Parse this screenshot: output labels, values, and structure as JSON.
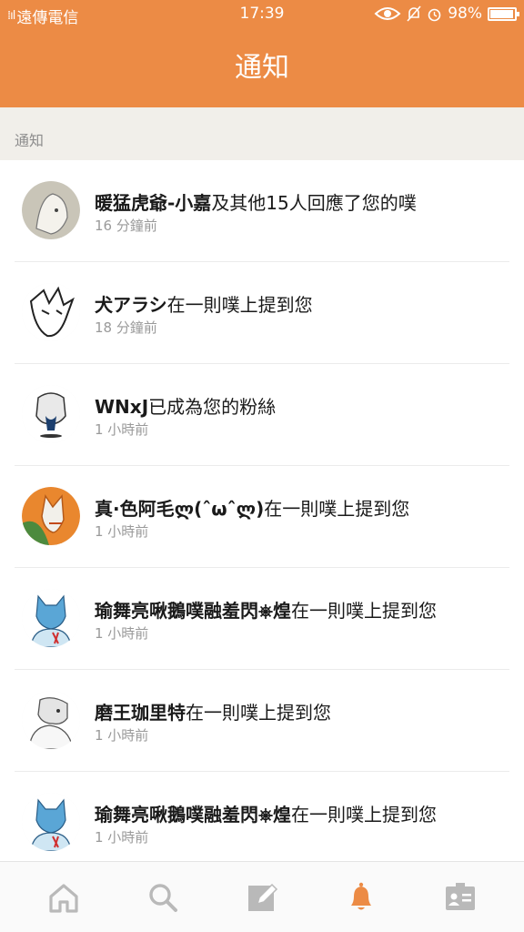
{
  "status_bar": {
    "carrier": "遠傳電信",
    "time": "17:39",
    "battery": "98%"
  },
  "header": {
    "title": "通知"
  },
  "section": {
    "label": "通知"
  },
  "notifications": [
    {
      "name": "暖猛虎爺-小嘉",
      "text": "及其他15人回應了您的噗",
      "time": "16 分鐘前",
      "avatar_color": "#c9c5b8"
    },
    {
      "name": "犬アラシ",
      "text": "在一則噗上提到您",
      "time": "18 分鐘前",
      "avatar_color": "#dcdcdc"
    },
    {
      "name": "WNxJ",
      "text": "已成為您的粉絲",
      "time": "1 小時前",
      "avatar_color": "#e8e8e8"
    },
    {
      "name": "真·色阿毛ლ(ˆωˆლ)",
      "text": "在一則噗上提到您",
      "time": "1 小時前",
      "avatar_color": "#e9872e"
    },
    {
      "name": "瑜舞亮啾鵝噗融羞閃⎈煌",
      "text": "在一則噗上提到您",
      "time": "1 小時前",
      "avatar_color": "#5aa6d6"
    },
    {
      "name": "磨王珈里特",
      "text": "在一則噗上提到您",
      "time": "1 小時前",
      "avatar_color": "#d9d9d9"
    },
    {
      "name": "瑜舞亮啾鵝噗融羞閃⎈煌",
      "text": "在一則噗上提到您",
      "time": "1 小時前",
      "avatar_color": "#5aa6d6"
    }
  ],
  "tabs": [
    {
      "icon": "home-icon",
      "active": false
    },
    {
      "icon": "search-icon",
      "active": false
    },
    {
      "icon": "compose-icon",
      "active": false
    },
    {
      "icon": "bell-icon",
      "active": true
    },
    {
      "icon": "profile-card-icon",
      "active": false
    }
  ],
  "colors": {
    "accent": "#ec8b45",
    "tab_inactive": "#b9b9b9",
    "tab_active": "#ec8b45"
  }
}
